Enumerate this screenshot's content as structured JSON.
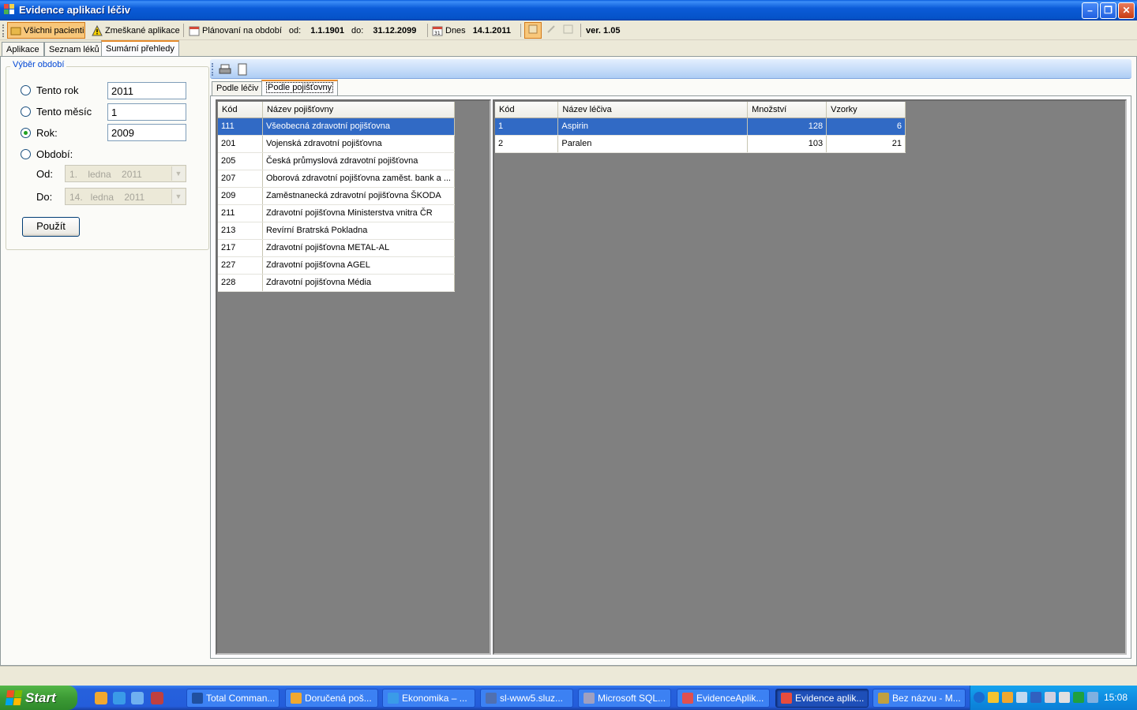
{
  "window": {
    "title": "Evidence aplikací léčiv"
  },
  "toolbar": {
    "all_patients": "Všichni pacienti",
    "missed": "Zmeškané aplikace",
    "planning": "Plánovaní na období",
    "from_label": "od:",
    "from_value": "1.1.1901",
    "to_label": "do:",
    "to_value": "31.12.2099",
    "today_label": "Dnes",
    "today_value": "14.1.2011",
    "version": "ver. 1.05"
  },
  "tabs": [
    "Aplikace",
    "Seznam léků",
    "Sumární přehledy"
  ],
  "period": {
    "legend": "Výběr období",
    "this_year_label": "Tento rok",
    "this_year_value": "2011",
    "this_month_label": "Tento měsíc",
    "this_month_value": "1",
    "year_label": "Rok:",
    "year_value": "2009",
    "period_label": "Období:",
    "from_label": "Od:",
    "from_value": "1.    ledna    2011",
    "to_label": "Do:",
    "to_value": "14.   ledna    2011",
    "apply_button": "Použít"
  },
  "subtabs": [
    "Podle léčiv",
    "Podle pojišťovny"
  ],
  "insurers": {
    "headers": [
      "Kód",
      "Název pojišťovny"
    ],
    "rows": [
      [
        "111",
        "Všeobecná zdravotní pojišťovna"
      ],
      [
        "201",
        "Vojenská zdravotní pojišťovna"
      ],
      [
        "205",
        "Česká průmyslová zdravotní pojišťovna"
      ],
      [
        "207",
        "Oborová zdravotní pojišťovna zaměst. bank a ..."
      ],
      [
        "209",
        "Zaměstnanecká zdravotní pojišťovna ŠKODA"
      ],
      [
        "211",
        "Zdravotní pojišťovna Ministerstva vnitra ČR"
      ],
      [
        "213",
        "Revírní Bratrská Pokladna"
      ],
      [
        "217",
        "Zdravotní pojišťovna METAL-AL"
      ],
      [
        "227",
        "Zdravotní pojišťovna AGEL"
      ],
      [
        "228",
        "Zdravotní pojišťovna Média"
      ]
    ]
  },
  "drugs": {
    "headers": [
      "Kód",
      "Název léčiva",
      "Množství",
      "Vzorky"
    ],
    "rows": [
      [
        "1",
        "Aspirin",
        "128",
        "6"
      ],
      [
        "2",
        "Paralen",
        "103",
        "21"
      ]
    ]
  },
  "taskbar": {
    "start": "Start",
    "tasks": [
      "Total Comman...",
      "Doručená poš...",
      "Ekonomika – ...",
      "sl-www5.sluz...",
      "Microsoft SQL...",
      "EvidenceAplik...",
      "Evidence aplik...",
      "Bez názvu - M..."
    ],
    "clock": "15:08"
  },
  "colors": {
    "selection": "#316ac5",
    "accent_tab": "#e68b2c",
    "taskbar": "#245ddb"
  }
}
